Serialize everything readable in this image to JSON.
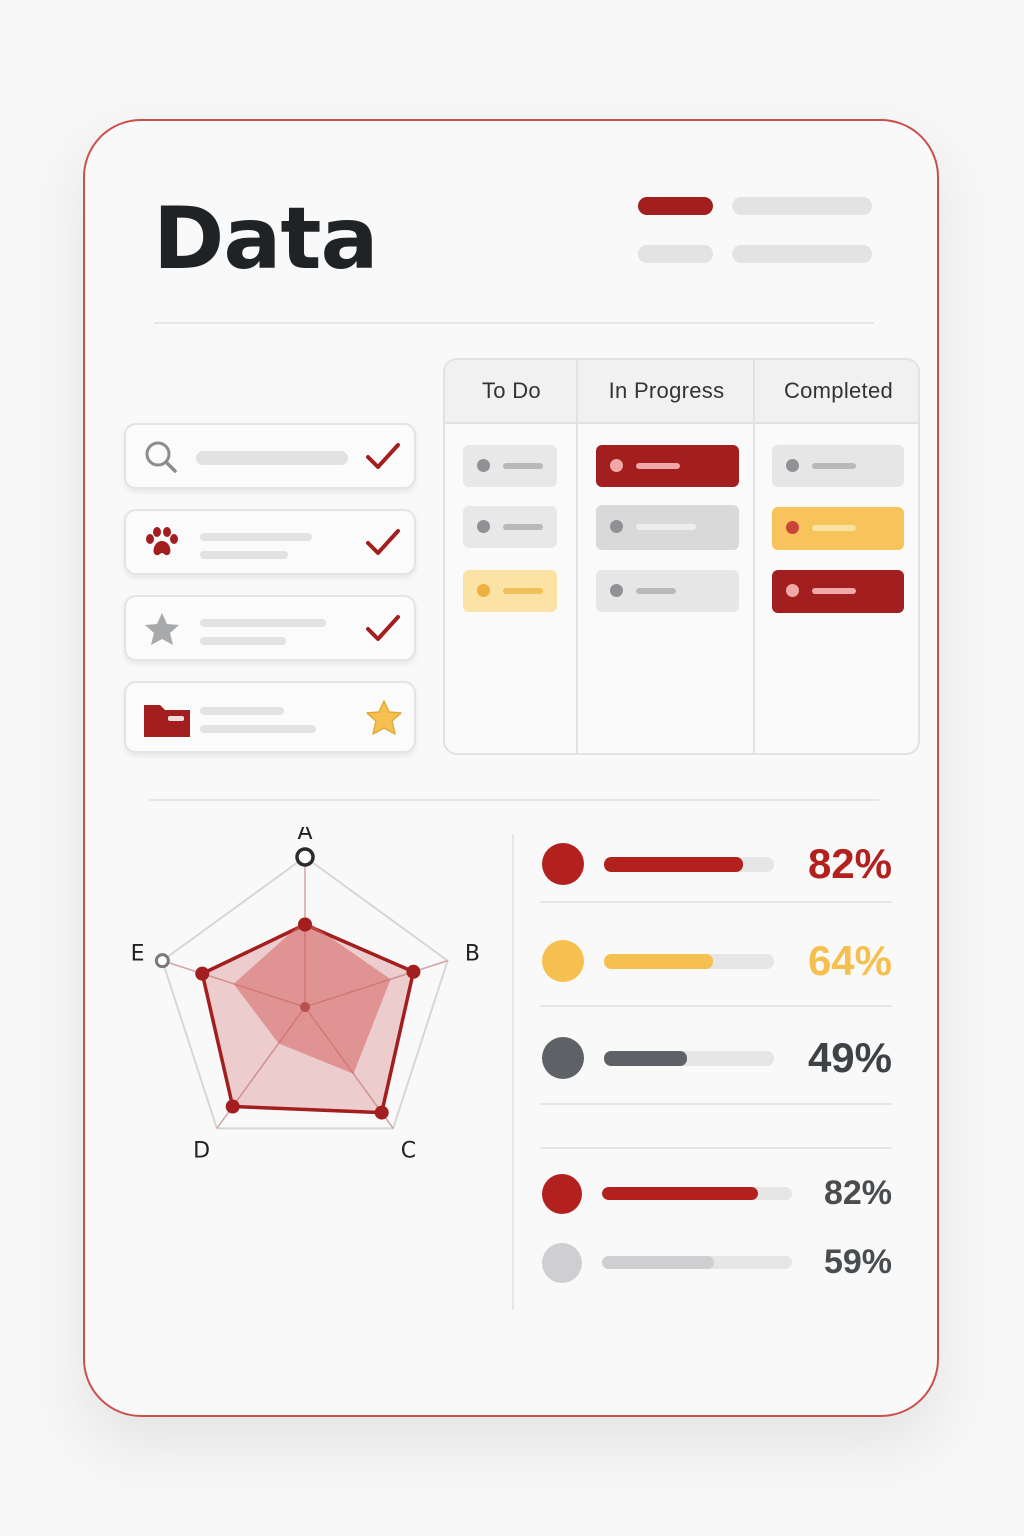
{
  "header": {
    "title": "Data"
  },
  "colors": {
    "accent": "#a31e1e",
    "yellow": "#f5c04f",
    "gray": "#5e6266",
    "light": "#cfcfd1"
  },
  "list_items": [
    {
      "icon": "search-icon",
      "status": "check-icon"
    },
    {
      "icon": "paw-icon",
      "status": "check-icon"
    },
    {
      "icon": "star-icon",
      "status": "check-icon"
    },
    {
      "icon": "folder-icon",
      "status": "star-icon"
    }
  ],
  "kanban": {
    "columns": [
      {
        "label": "To Do",
        "cards": [
          "gray",
          "gray",
          "yellow"
        ]
      },
      {
        "label": "In Progress",
        "cards": [
          "red",
          "gray",
          "gray"
        ]
      },
      {
        "label": "Completed",
        "cards": [
          "gray",
          "yellow",
          "red"
        ]
      }
    ]
  },
  "radar": {
    "axes": [
      "A",
      "B",
      "C",
      "D",
      "E"
    ],
    "outer_series": [
      0.55,
      0.76,
      0.87,
      0.82,
      0.72
    ],
    "inner_series": [
      0.58,
      0.6,
      0.55,
      0.3,
      0.5
    ]
  },
  "metrics": [
    {
      "label": "82%",
      "value": 0.82,
      "color": "#b3211f",
      "dot": "#b3211f"
    },
    {
      "label": "64%",
      "value": 0.64,
      "color": "#f5c04f",
      "dot": "#f5c04f"
    },
    {
      "label": "49%",
      "value": 0.49,
      "color": "#5e6266",
      "dot": "#5e6266"
    }
  ],
  "metrics_secondary": [
    {
      "label": "82%",
      "value": 0.82,
      "color": "#b3211f",
      "dot": "#b3211f"
    },
    {
      "label": "59%",
      "value": 0.59,
      "color": "#cfcfd1",
      "dot": "#cfcfd1"
    }
  ]
}
